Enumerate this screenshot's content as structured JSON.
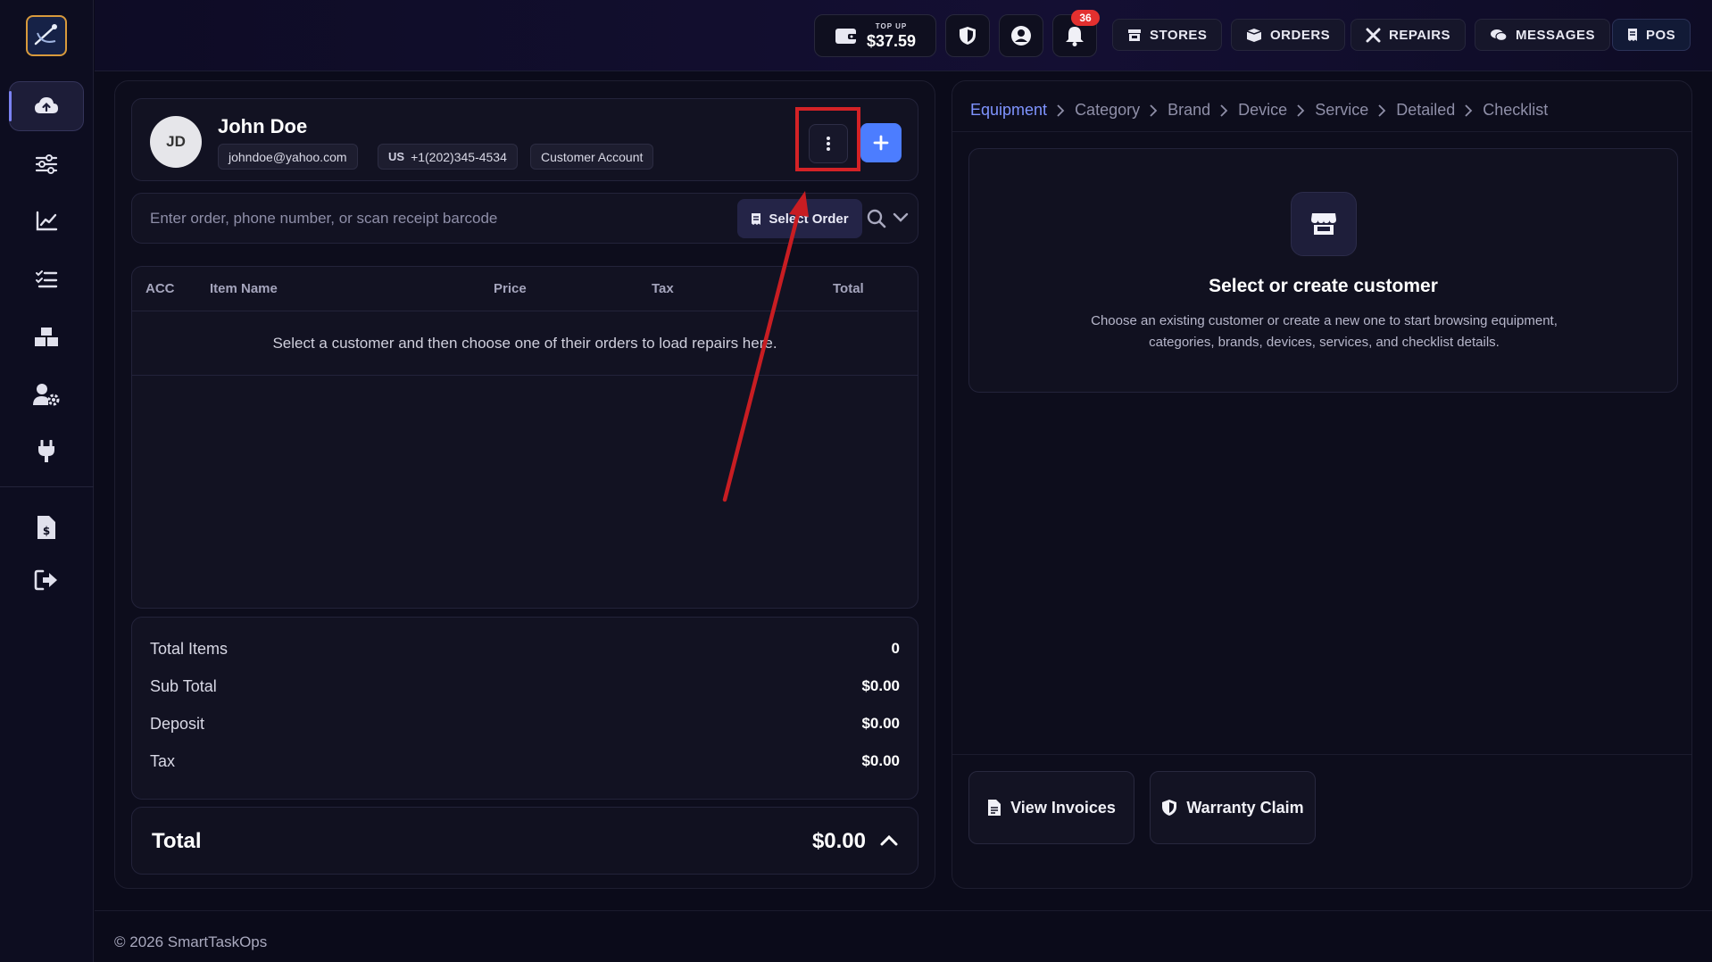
{
  "topbar": {
    "wallet": {
      "topup_label": "TOP UP",
      "balance": "$37.59"
    },
    "notifications_count": "36",
    "nav": [
      {
        "label": "STORES",
        "icon": "store-icon"
      },
      {
        "label": "ORDERS",
        "icon": "box-icon"
      },
      {
        "label": "REPAIRS",
        "icon": "tools-icon"
      },
      {
        "label": "MESSAGES",
        "icon": "chat-icon"
      },
      {
        "label": "POS",
        "icon": "receipt-icon"
      }
    ]
  },
  "sidebar": {
    "items": [
      {
        "icon": "cloud-upload-icon",
        "active": true
      },
      {
        "icon": "sliders-icon"
      },
      {
        "icon": "chart-line-icon"
      },
      {
        "icon": "checklist-icon"
      },
      {
        "icon": "boxes-icon"
      },
      {
        "icon": "user-gear-icon"
      },
      {
        "icon": "plug-icon"
      },
      {
        "icon": "invoice-icon"
      },
      {
        "icon": "logout-icon"
      }
    ]
  },
  "customer": {
    "initials": "JD",
    "name": "John Doe",
    "email": "johndoe@yahoo.com",
    "country_code": "US",
    "phone": "+1(202)345-4534",
    "account_type": "Customer Account"
  },
  "search": {
    "placeholder": "Enter order, phone number, or scan receipt barcode",
    "select_order_label": "Select Order"
  },
  "table": {
    "columns": [
      "ACC",
      "Item Name",
      "Price",
      "Tax",
      "Total"
    ],
    "empty_message": "Select a customer and then choose one of their orders to load repairs here."
  },
  "summary": {
    "rows": [
      {
        "label": "Total Items",
        "value": "0"
      },
      {
        "label": "Sub Total",
        "value": "$0.00"
      },
      {
        "label": "Deposit",
        "value": "$0.00"
      },
      {
        "label": "Tax",
        "value": "$0.00"
      }
    ],
    "total_label": "Total",
    "total_value": "$0.00"
  },
  "breadcrumbs": [
    "Equipment",
    "Category",
    "Brand",
    "Device",
    "Service",
    "Detailed",
    "Checklist"
  ],
  "select_panel": {
    "title": "Select or create customer",
    "description": "Choose an existing customer or create a new one to start browsing equipment, categories, brands, devices, services, and checklist details."
  },
  "actions": {
    "view_invoices": "View Invoices",
    "warranty_claim": "Warranty Claim"
  },
  "footer": {
    "copyright": "© 2026 SmartTaskOps"
  },
  "colors": {
    "accent": "#4c7dff",
    "annotation": "#d42226",
    "badge": "#e3302f"
  }
}
